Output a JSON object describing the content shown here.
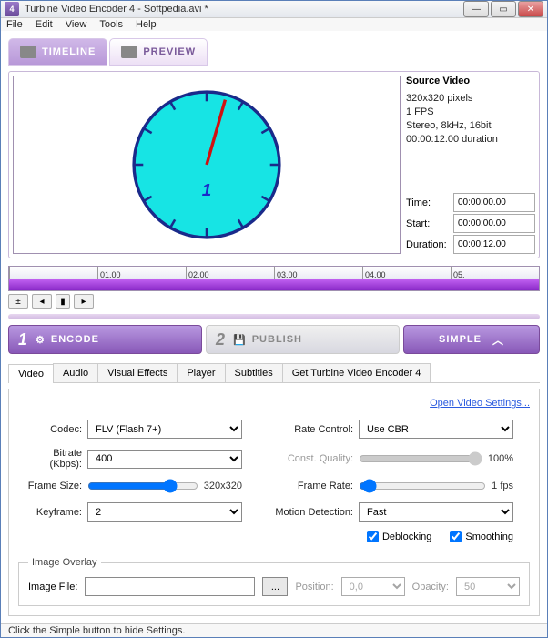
{
  "window": {
    "title": "Turbine Video Encoder 4 - Softpedia.avi *"
  },
  "menu": {
    "file": "File",
    "edit": "Edit",
    "view": "View",
    "tools": "Tools",
    "help": "Help"
  },
  "top_tabs": {
    "timeline": "TIMELINE",
    "preview": "PREVIEW"
  },
  "source": {
    "title": "Source Video",
    "dimensions": "320x320 pixels",
    "fps": "1 FPS",
    "audio": "Stereo, 8kHz, 16bit",
    "duration": "00:00:12.00 duration"
  },
  "time_fields": {
    "time_label": "Time:",
    "time_val": "00:00:00.00",
    "start_label": "Start:",
    "start_val": "00:00:00.00",
    "duration_label": "Duration:",
    "duration_val": "00:00:12.00"
  },
  "timeline": {
    "ticks": [
      "01.00",
      "02.00",
      "03.00",
      "04.00",
      "05."
    ]
  },
  "actions": {
    "encode": "ENCODE",
    "publish": "PUBLISH",
    "simple": "SIMPLE"
  },
  "subtabs": {
    "video": "Video",
    "audio": "Audio",
    "vfx": "Visual Effects",
    "player": "Player",
    "subtitles": "Subtitles",
    "get": "Get Turbine Video Encoder 4"
  },
  "link": {
    "open_settings": "Open Video Settings..."
  },
  "form": {
    "codec_label": "Codec:",
    "codec_value": "FLV (Flash 7+)",
    "rate_label": "Rate Control:",
    "rate_value": "Use CBR",
    "bitrate_label": "Bitrate (Kbps):",
    "bitrate_value": "400",
    "const_q_label": "Const. Quality:",
    "const_q_readout": "100%",
    "framesize_label": "Frame Size:",
    "framesize_readout": "320x320",
    "framerate_label": "Frame Rate:",
    "framerate_readout": "1 fps",
    "keyframe_label": "Keyframe:",
    "keyframe_value": "2",
    "motion_label": "Motion Detection:",
    "motion_value": "Fast",
    "deblocking_label": "Deblocking",
    "smoothing_label": "Smoothing"
  },
  "overlay": {
    "legend": "Image Overlay",
    "file_label": "Image File:",
    "file_value": "",
    "position_label": "Position:",
    "position_value": "0,0",
    "opacity_label": "Opacity:",
    "opacity_value": "50"
  },
  "status": {
    "text": "Click the Simple button to hide Settings."
  }
}
